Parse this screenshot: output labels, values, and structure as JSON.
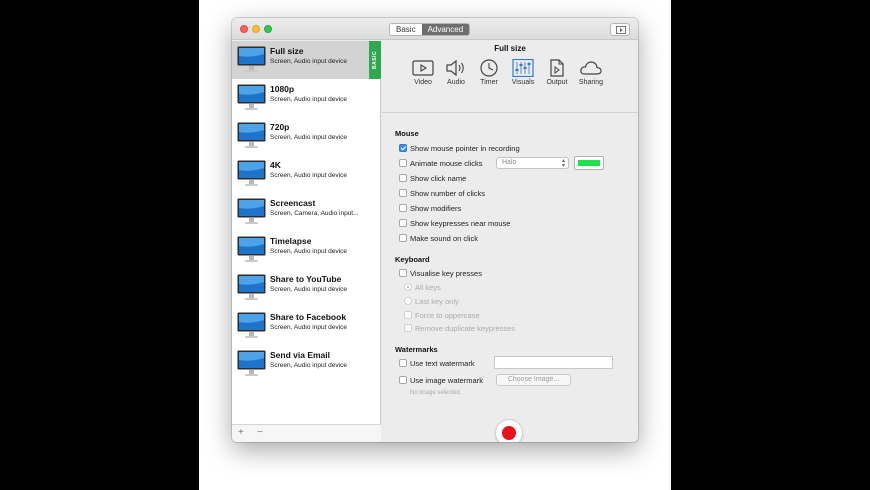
{
  "window": {
    "segmented": [
      "Basic",
      "Advanced"
    ],
    "selected_mode": "Advanced"
  },
  "sidebar": {
    "presets": [
      {
        "name": "Full size",
        "desc": "Screen, Audio input device",
        "selected": true,
        "badge": "BASIC"
      },
      {
        "name": "1080p",
        "desc": "Screen, Audio input device"
      },
      {
        "name": "720p",
        "desc": "Screen, Audio input device"
      },
      {
        "name": "4K",
        "desc": "Screen, Audio input device"
      },
      {
        "name": "Screencast",
        "desc": "Screen, Camera, Audio input..."
      },
      {
        "name": "Timelapse",
        "desc": "Screen, Audio input device"
      },
      {
        "name": "Share to YouTube",
        "desc": "Screen, Audio input device"
      },
      {
        "name": "Share to Facebook",
        "desc": "Screen, Audio input device"
      },
      {
        "name": "Send via Email",
        "desc": "Screen, Audio input device"
      }
    ],
    "add_label": "+",
    "remove_label": "−"
  },
  "main": {
    "title": "Full size",
    "tabs": [
      {
        "label": "Video",
        "icon": "video-icon"
      },
      {
        "label": "Audio",
        "icon": "speaker-icon"
      },
      {
        "label": "Timer",
        "icon": "clock-icon"
      },
      {
        "label": "Visuals",
        "icon": "sliders-icon",
        "selected": true
      },
      {
        "label": "Output",
        "icon": "document-icon"
      },
      {
        "label": "Sharing",
        "icon": "cloud-icon"
      }
    ],
    "mouse": {
      "heading": "Mouse",
      "show_pointer": "Show mouse pointer in recording",
      "animate_clicks": "Animate mouse clicks",
      "animation_style": "Halo",
      "click_color": "#1ee04a",
      "show_click_name": "Show click name",
      "show_number_of_clicks": "Show number of clicks",
      "show_modifiers": "Show modifiers",
      "show_keypresses": "Show keypresses near mouse",
      "make_sound": "Make sound on click"
    },
    "keyboard": {
      "heading": "Keyboard",
      "visualise": "Visualise key presses",
      "all_keys": "All keys",
      "last_key_only": "Last key only",
      "force_uppercase": "Force to uppercase",
      "remove_duplicates": "Remove duplicate keypresses"
    },
    "watermarks": {
      "heading": "Watermarks",
      "use_text": "Use text watermark",
      "use_image": "Use image watermark",
      "choose_image": "Choose Image...",
      "no_image": "No image selected."
    }
  }
}
